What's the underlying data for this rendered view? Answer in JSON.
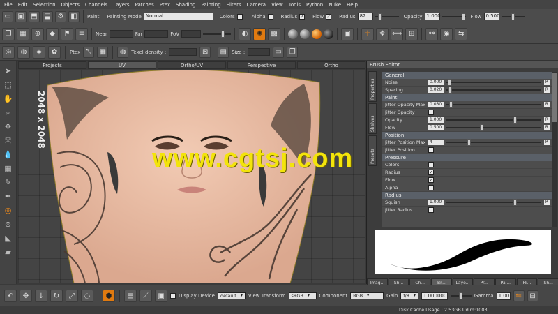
{
  "menu": [
    "File",
    "Edit",
    "Selection",
    "Objects",
    "Channels",
    "Layers",
    "Patches",
    "Ptex",
    "Shading",
    "Painting",
    "Filters",
    "Camera",
    "View",
    "Tools",
    "Python",
    "Nuke",
    "Help"
  ],
  "paintbar": {
    "paint_label": "Paint",
    "mode_label": "Painting Mode",
    "mode_value": "Normal",
    "colors_label": "Colors",
    "alpha_label": "Alpha",
    "radius_chk_label": "Radius",
    "flow_chk_label": "Flow",
    "radius_label": "Radius",
    "radius_value": "82",
    "opacity_label": "Opacity",
    "opacity_value": "1.000",
    "flow_label": "Flow",
    "flow_value": "0.500"
  },
  "camera": {
    "near_label": "Near",
    "far_label": "Far",
    "fov_label": "FoV"
  },
  "ptex": {
    "ptex_label": "Ptex",
    "texel_label": "Texel density :",
    "size_label": "Size :"
  },
  "tabs": [
    "Projects",
    "UV",
    "Ortho/UV",
    "Perspective",
    "Ortho"
  ],
  "active_tab": "UV",
  "viewport": {
    "texture_size_label": "2048 x 2048",
    "watermark": "www.cgtsj.com"
  },
  "brush_editor": {
    "title": "Brush Editor",
    "side_tabs": [
      "Properties",
      "Shelves",
      "Presets"
    ],
    "sections": [
      {
        "name": "General",
        "rows": [
          {
            "label": "Noise",
            "value": "0.000",
            "reset": "R"
          },
          {
            "label": "Spacing",
            "value": "0.020",
            "reset": "R"
          }
        ]
      },
      {
        "name": "Paint",
        "rows": [
          {
            "label": "Jitter Opacity Max",
            "value": "0.080",
            "reset": "R"
          },
          {
            "label": "Jitter Opacity",
            "value": "",
            "reset": ""
          },
          {
            "label": "Opacity",
            "value": "1.000",
            "reset": "R"
          },
          {
            "label": "Flow",
            "value": "0.500",
            "reset": "R"
          }
        ]
      },
      {
        "name": "Position",
        "rows": [
          {
            "label": "Jitter Position Max",
            "value": "4",
            "reset": "R"
          },
          {
            "label": "Jitter Position",
            "value": "",
            "reset": ""
          }
        ]
      },
      {
        "name": "Pressure",
        "rows": [
          {
            "label": "Colors",
            "value": "",
            "reset": ""
          },
          {
            "label": "Radius",
            "value": "",
            "reset": ""
          },
          {
            "label": "Flow",
            "value": "",
            "reset": ""
          },
          {
            "label": "Alpha",
            "value": "",
            "reset": ""
          }
        ]
      },
      {
        "name": "Radius",
        "rows": [
          {
            "label": "Squish",
            "value": "1.000",
            "reset": "R"
          },
          {
            "label": "Jitter Radius",
            "value": "",
            "reset": ""
          }
        ]
      }
    ],
    "bottom_tabs": [
      "Imag...",
      "Sh...",
      "Ch...",
      "Br...",
      "Laye...",
      "Pr...",
      "Pai...",
      "Hi...",
      "Sh..."
    ],
    "active_bottom_tab": "Br..."
  },
  "bottombar": {
    "display_device_label": "Display Device",
    "display_device_value": "default",
    "view_transform_label": "View Transform",
    "view_transform_value": "sRGB",
    "component_label": "Component",
    "component_value": "RGB",
    "gain_label": "Gain",
    "gain_fstop": "f/8",
    "gain_value": "1.000000",
    "gamma_label": "Gamma",
    "gamma_value": "1.00"
  },
  "status": {
    "message": "Disk Cache Usage : 2.53GB  Udim:1003"
  },
  "colors": {
    "accent": "#e07a10",
    "watermark": "#f3e40b",
    "skin": "#e8b8a0"
  }
}
